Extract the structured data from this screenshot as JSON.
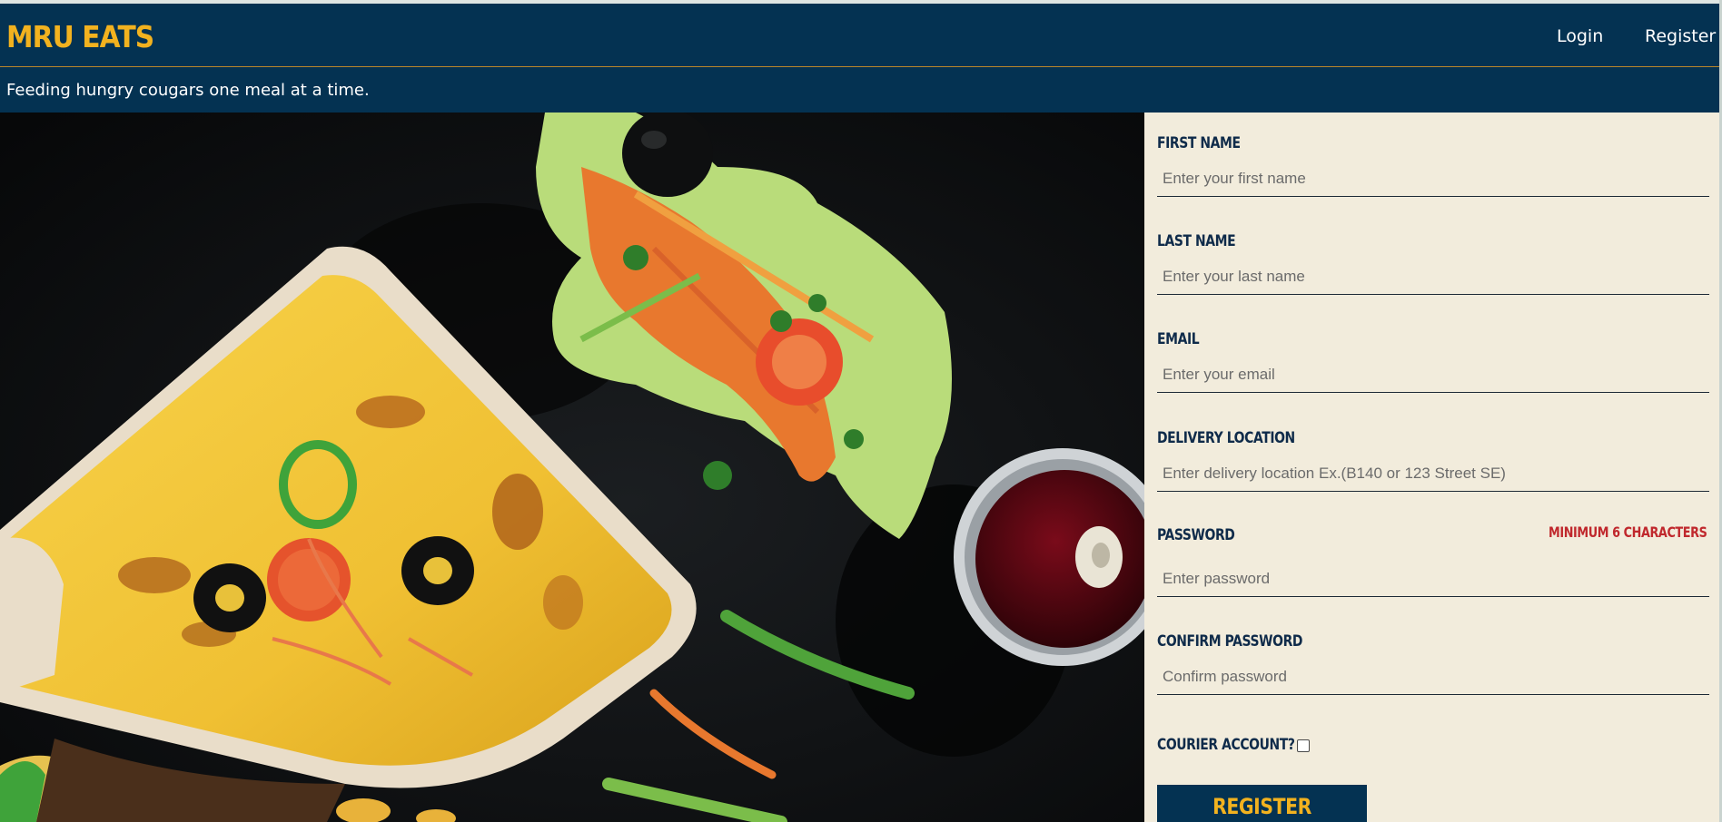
{
  "header": {
    "brand": "MRU EATS",
    "nav": {
      "login": "Login",
      "register": "Register"
    },
    "tagline": "Feeding hungry cougars one meal at a time."
  },
  "form": {
    "first_name": {
      "label": "First Name",
      "placeholder": "Enter your first name"
    },
    "last_name": {
      "label": "Last Name",
      "placeholder": "Enter your last name"
    },
    "email": {
      "label": "Email",
      "placeholder": "Enter your email"
    },
    "delivery_location": {
      "label": "Delivery Location",
      "placeholder": "Enter delivery location Ex.(B140 or 123 Street SE)"
    },
    "password": {
      "label": "Password",
      "note": "Minimum 6 characters",
      "placeholder": "Enter password"
    },
    "confirm_password": {
      "label": "Confirm Password",
      "placeholder": "Confirm password"
    },
    "courier": {
      "label": "Courier Account?",
      "checked": false
    },
    "submit_label": "Register"
  },
  "colors": {
    "navy": "#043252",
    "gold": "#f2b21f",
    "cream": "#f2ecdc",
    "warning_red": "#c0282d"
  }
}
